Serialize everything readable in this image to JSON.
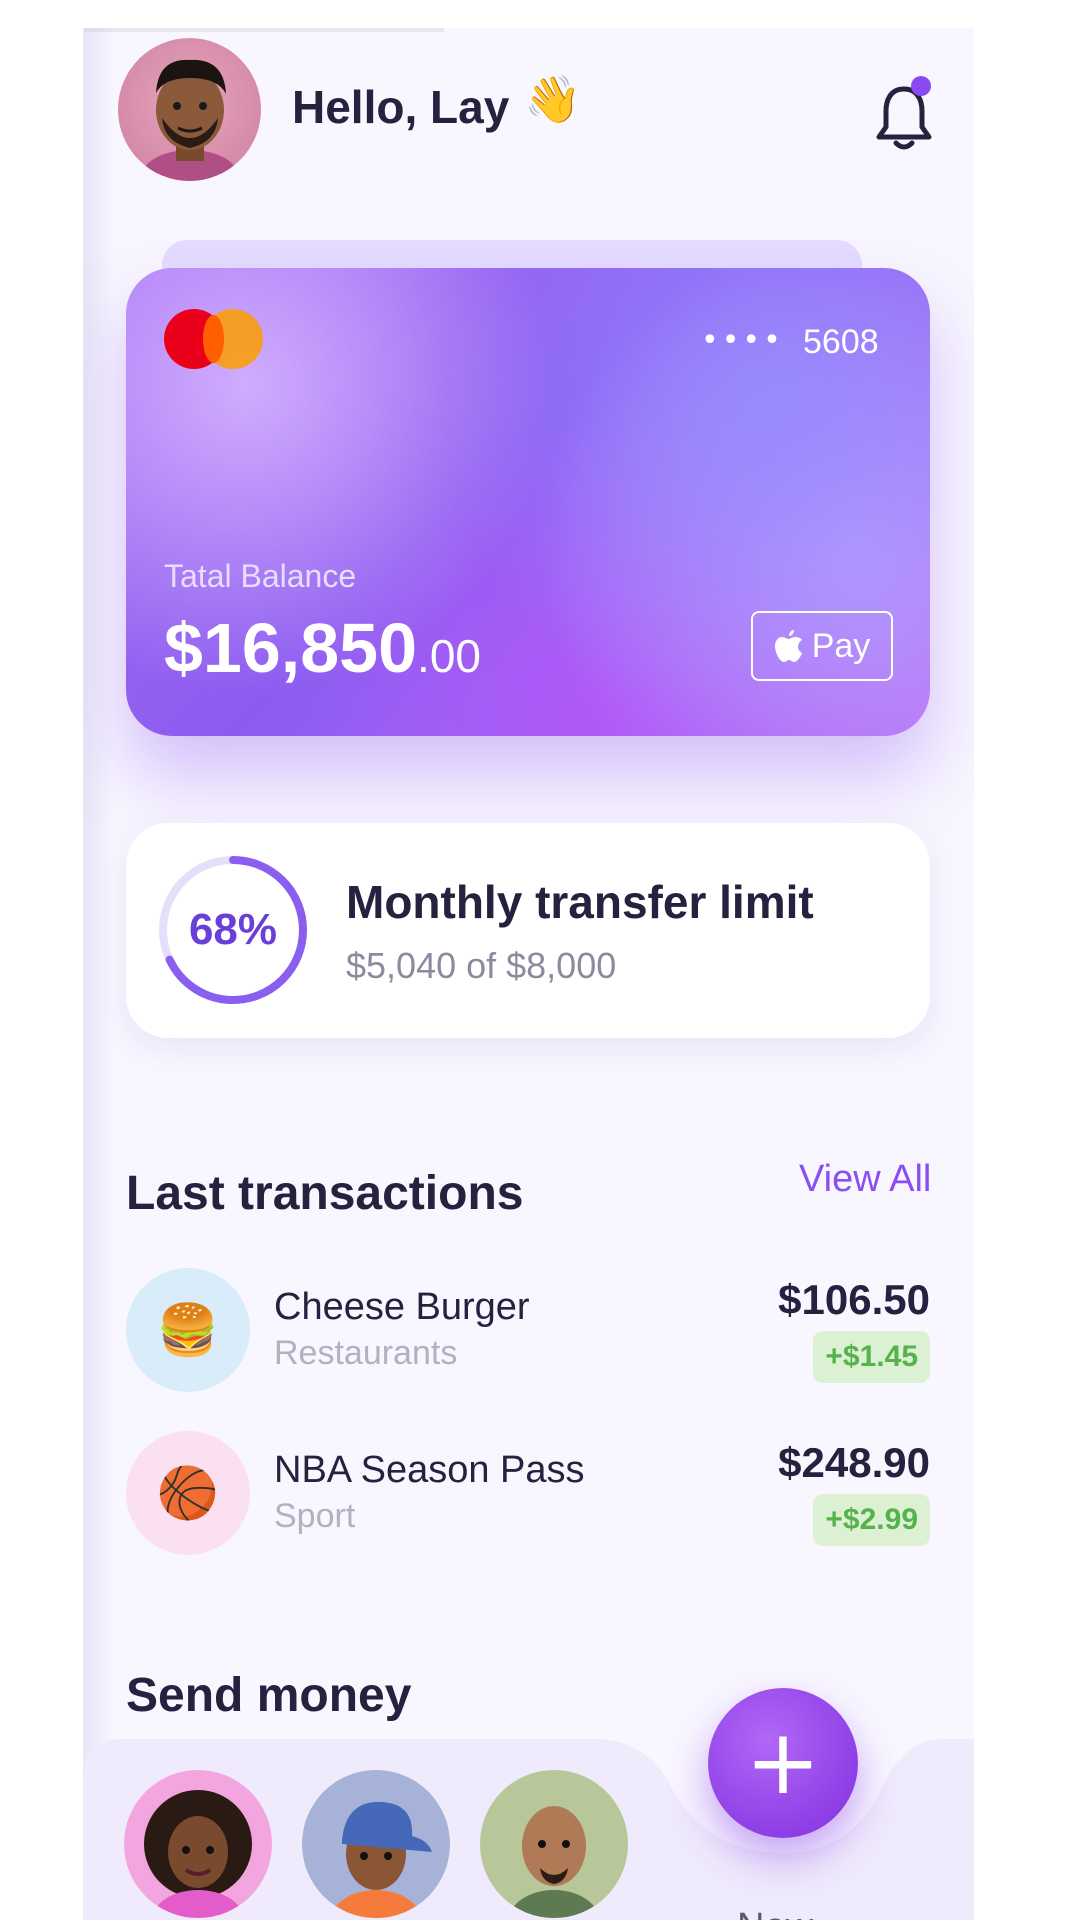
{
  "header": {
    "greeting": "Hello, Lay",
    "wave_emoji": "👋"
  },
  "card": {
    "dots": "••••",
    "last4": "5608",
    "balance_label": "Tatal Balance",
    "balance_main": "$16,850",
    "balance_cents": ".00",
    "pay_label": "Pay"
  },
  "limit": {
    "percent_text": "68%",
    "percent": 68,
    "title": "Monthly transfer limit",
    "subtitle": "$5,040 of $8,000"
  },
  "transactions": {
    "title": "Last transactions",
    "view_all": "View All",
    "items": [
      {
        "emoji": "🍔",
        "name": "Cheese Burger",
        "category": "Restaurants",
        "amount": "$106.50",
        "cashback": "+$1.45",
        "icon_bg": "#d8ecf9"
      },
      {
        "emoji": "🏀",
        "name": "NBA Season Pass",
        "category": "Sport",
        "amount": "$248.90",
        "cashback": "+$2.99",
        "icon_bg": "#fae0f1"
      }
    ]
  },
  "send_money": {
    "title": "Send money",
    "fab_symbol": "+",
    "new_label": "New"
  },
  "colors": {
    "accent": "#8b4ef0",
    "cashback_bg": "#dcf0d3",
    "cashback_text": "#56b34b"
  }
}
